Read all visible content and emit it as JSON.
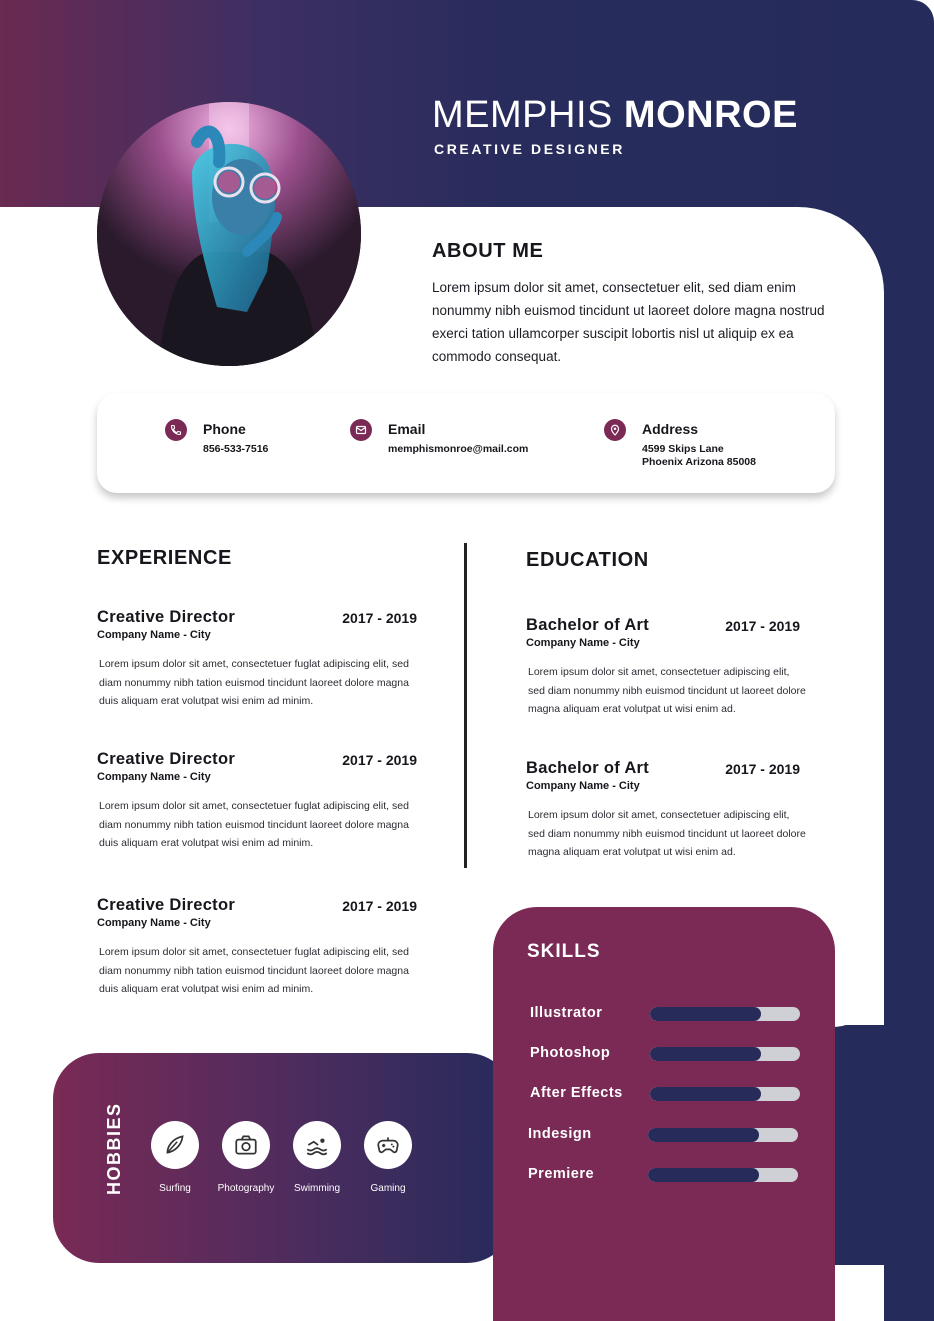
{
  "header": {
    "first_name": "MEMPHIS",
    "last_name": "MONROE",
    "job_title": "CREATIVE DESIGNER"
  },
  "about": {
    "heading": "ABOUT ME",
    "text": "Lorem ipsum dolor sit amet, consectetuer elit, sed diam enim nonummy nibh euismod tincidunt ut laoreet dolore magna nostrud exerci tation ullamcorper suscipit lobortis nisl ut aliquip ex ea commodo consequat."
  },
  "contact": {
    "phone": {
      "label": "Phone",
      "value": "856-533-7516",
      "icon": "phone-icon"
    },
    "email": {
      "label": "Email",
      "value": "memphismonroe@mail.com",
      "icon": "mail-icon"
    },
    "address": {
      "label": "Address",
      "line1": "4599 Skips Lane",
      "line2": "Phoenix Arizona 85008",
      "icon": "location-pin-icon"
    }
  },
  "experience": {
    "heading": "EXPERIENCE",
    "items": [
      {
        "title": "Creative Director",
        "years": "2017 - 2019",
        "sub": "Company Name - City",
        "desc": "Lorem ipsum dolor sit amet, consectetuer fuglat adipiscing elit, sed diam nonummy nibh tation euismod tincidunt laoreet dolore magna duis aliquam erat volutpat wisi enim ad minim."
      },
      {
        "title": "Creative Director",
        "years": "2017 - 2019",
        "sub": "Company Name - City",
        "desc": "Lorem ipsum dolor sit amet, consectetuer fuglat adipiscing elit, sed diam nonummy nibh tation euismod tincidunt laoreet dolore magna duis aliquam erat volutpat wisi enim ad minim."
      },
      {
        "title": "Creative Director",
        "years": "2017 - 2019",
        "sub": "Company Name - City",
        "desc": "Lorem ipsum dolor sit amet, consectetuer fuglat adipiscing elit, sed diam nonummy nibh tation euismod tincidunt laoreet dolore magna duis aliquam erat volutpat wisi enim ad minim."
      }
    ]
  },
  "education": {
    "heading": "EDUCATION",
    "items": [
      {
        "title": "Bachelor of Art",
        "years": "2017 - 2019",
        "sub": "Company Name - City",
        "desc": "Lorem ipsum dolor sit amet, consectetuer adipiscing elit, sed diam nonummy nibh euismod tincidunt ut laoreet dolore magna aliquam erat volutpat ut wisi enim ad."
      },
      {
        "title": "Bachelor of Art",
        "years": "2017 - 2019",
        "sub": "Company Name - City",
        "desc": "Lorem ipsum dolor sit amet, consectetuer adipiscing elit, sed diam nonummy nibh euismod tincidunt ut laoreet dolore magna aliquam erat volutpat ut wisi enim ad."
      }
    ]
  },
  "hobbies": {
    "heading": "HOBBIES",
    "items": [
      {
        "label": "Surfing",
        "icon": "surfboard-icon"
      },
      {
        "label": "Photography",
        "icon": "camera-icon"
      },
      {
        "label": "Swimming",
        "icon": "swimmer-icon"
      },
      {
        "label": "Gaming",
        "icon": "gamepad-icon"
      }
    ]
  },
  "skills": {
    "heading": "SKILLS",
    "items": [
      {
        "name": "Illustrator",
        "level": 0.74
      },
      {
        "name": "Photoshop",
        "level": 0.74
      },
      {
        "name": "After Effects",
        "level": 0.74
      },
      {
        "name": "Indesign",
        "level": 0.74
      },
      {
        "name": "Premiere",
        "level": 0.74
      }
    ]
  },
  "colors": {
    "navy": "#252b5b",
    "plum": "#7a2a55",
    "track": "#cfcfd6"
  }
}
